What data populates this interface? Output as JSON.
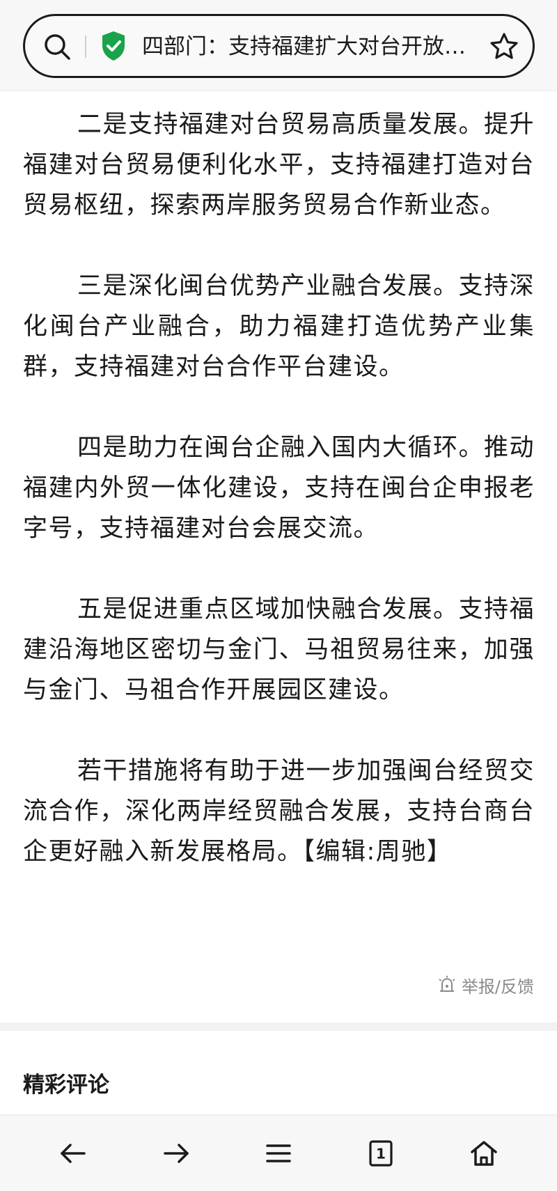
{
  "address_bar": {
    "page_title": "四部门：支持福建扩大对台开放…"
  },
  "article": {
    "paragraphs": [
      "二是支持福建对台贸易高质量发展。提升福建对台贸易便利化水平，支持福建打造对台贸易枢纽，探索两岸服务贸易合作新业态。",
      "三是深化闽台优势产业融合发展。支持深化闽台产业融合，助力福建打造优势产业集群，支持福建对台合作平台建设。",
      "四是助力在闽台企融入国内大循环。推动福建内外贸一体化建设，支持在闽台企申报老字号，支持福建对台会展交流。",
      "五是促进重点区域加快融合发展。支持福建沿海地区密切与金门、马祖贸易往来，加强与金门、马祖合作开展园区建设。",
      "若干措施将有助于进一步加强闽台经贸交流合作，深化两岸经贸融合发展，支持台商台企更好融入新发展格局。【编辑:周驰】"
    ],
    "report_label": "举报/反馈"
  },
  "comments": {
    "title": "精彩评论"
  },
  "bottom_nav": {
    "tab_count": "1",
    "icons": [
      "back-arrow-icon",
      "forward-arrow-icon",
      "menu-icon",
      "tabs-icon",
      "home-icon"
    ]
  },
  "colors": {
    "shield_green": "#1aa34a",
    "text": "#1a1a1a",
    "muted": "#8a8a8a"
  }
}
